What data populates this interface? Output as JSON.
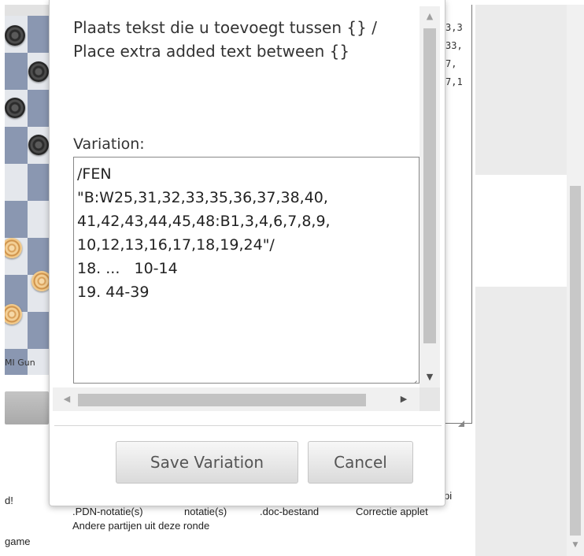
{
  "background": {
    "player_name": "MI Gun",
    "moves_fragments": [
      "3,3",
      "33,",
      "7,",
      "7,1"
    ],
    "links": {
      "left_fragment": "d!",
      "pdn": ".PDN-notatie(s)",
      "notatie": "notatie(s)",
      "doc": ".doc-bestand",
      "correctie": "Correctie applet",
      "pi": "pi",
      "andere": "Andere partijen uit deze ronde",
      "game": "game"
    }
  },
  "dialog": {
    "instructions": "Plaats tekst die u toevoegt tussen {} / Place extra added text between {}",
    "variation_label": "Variation:",
    "variation_lines": [
      "/FEN",
      "\"B:W25,31,32,33,35,36,37,38,40,",
      "41,42,43,44,45,48:B1,3,4,6,7,8,9,",
      "10,12,13,16,17,18,19,24\"/",
      "18. ...   10-14",
      "19. 44-39"
    ],
    "save_button": "Save Variation",
    "cancel_button": "Cancel"
  },
  "icons": {
    "scroll_up": "arrow-up-icon",
    "scroll_down": "arrow-down-icon",
    "scroll_left": "arrow-left-icon",
    "scroll_right": "arrow-right-icon"
  }
}
